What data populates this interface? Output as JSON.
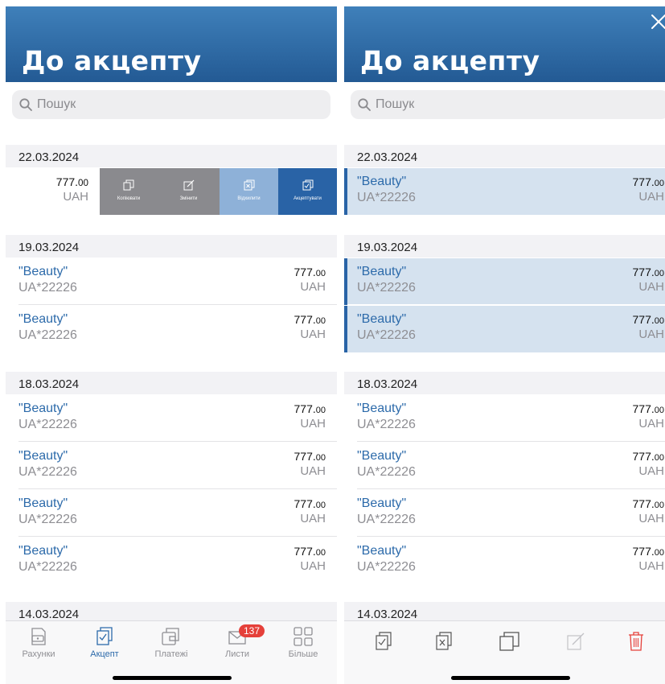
{
  "left": {
    "title": "До акцепту",
    "search_placeholder": "Пошук",
    "swipe_row": {
      "amount_main": "777.",
      "amount_cents": "00",
      "currency": "UAH",
      "actions": [
        {
          "label": "Копіювати",
          "color": "#8a8a8e",
          "icon": "copy-icon"
        },
        {
          "label": "Змінити",
          "color": "#8a8a8e",
          "icon": "edit-icon"
        },
        {
          "label": "Відхилити",
          "color": "#8eb1d8",
          "icon": "reject-icon"
        },
        {
          "label": "Акцептувати",
          "color": "#2963a6",
          "icon": "accept-icon"
        }
      ]
    },
    "sections": [
      {
        "date": "22.03.2024"
      },
      {
        "date": "19.03.2024",
        "rows": [
          {
            "name": "\"Beauty\"",
            "account": "UA*22226",
            "amount_main": "777.",
            "amount_cents": "00",
            "currency": "UAH"
          },
          {
            "name": "\"Beauty\"",
            "account": "UA*22226",
            "amount_main": "777.",
            "amount_cents": "00",
            "currency": "UAH"
          }
        ]
      },
      {
        "date": "18.03.2024",
        "rows": [
          {
            "name": "\"Beauty\"",
            "account": "UA*22226",
            "amount_main": "777.",
            "amount_cents": "00",
            "currency": "UAH"
          },
          {
            "name": "\"Beauty\"",
            "account": "UA*22226",
            "amount_main": "777.",
            "amount_cents": "00",
            "currency": "UAH"
          },
          {
            "name": "\"Beauty\"",
            "account": "UA*22226",
            "amount_main": "777.",
            "amount_cents": "00",
            "currency": "UAH"
          },
          {
            "name": "\"Beauty\"",
            "account": "UA*22226",
            "amount_main": "777.",
            "amount_cents": "00",
            "currency": "UAH"
          }
        ]
      },
      {
        "date": "14.03.2024"
      }
    ],
    "tabs": [
      {
        "label": "Рахунки",
        "icon": "wallet-icon"
      },
      {
        "label": "Акцепт",
        "icon": "accept-icon",
        "active": true
      },
      {
        "label": "Платежі",
        "icon": "payments-icon"
      },
      {
        "label": "Листи",
        "icon": "mail-icon",
        "badge": "137"
      },
      {
        "label": "Більше",
        "icon": "grid-icon"
      }
    ]
  },
  "right": {
    "title": "До акцепту",
    "search_placeholder": "Пошук",
    "sections": [
      {
        "date": "22.03.2024",
        "rows": [
          {
            "name": "\"Beauty\"",
            "account": "UA*22226",
            "amount_main": "777.",
            "amount_cents": "00",
            "currency": "UAH",
            "selected": true
          }
        ]
      },
      {
        "date": "19.03.2024",
        "rows": [
          {
            "name": "\"Beauty\"",
            "account": "UA*22226",
            "amount_main": "777.",
            "amount_cents": "00",
            "currency": "UAH",
            "selected": true
          },
          {
            "name": "\"Beauty\"",
            "account": "UA*22226",
            "amount_main": "777.",
            "amount_cents": "00",
            "currency": "UAH",
            "selected": true
          }
        ]
      },
      {
        "date": "18.03.2024",
        "rows": [
          {
            "name": "\"Beauty\"",
            "account": "UA*22226",
            "amount_main": "777.",
            "amount_cents": "00",
            "currency": "UAH"
          },
          {
            "name": "\"Beauty\"",
            "account": "UA*22226",
            "amount_main": "777.",
            "amount_cents": "00",
            "currency": "UAH"
          },
          {
            "name": "\"Beauty\"",
            "account": "UA*22226",
            "amount_main": "777.",
            "amount_cents": "00",
            "currency": "UAH"
          },
          {
            "name": "\"Beauty\"",
            "account": "UA*22226",
            "amount_main": "777.",
            "amount_cents": "00",
            "currency": "UAH"
          }
        ]
      },
      {
        "date": "14.03.2024"
      }
    ],
    "toolbar": [
      {
        "icon": "accept-icon",
        "enabled": true
      },
      {
        "icon": "reject-icon",
        "enabled": true
      },
      {
        "icon": "copy-icon",
        "enabled": true
      },
      {
        "icon": "edit-icon",
        "enabled": false
      },
      {
        "icon": "trash-icon",
        "enabled": true,
        "color": "#e5403a"
      }
    ]
  }
}
